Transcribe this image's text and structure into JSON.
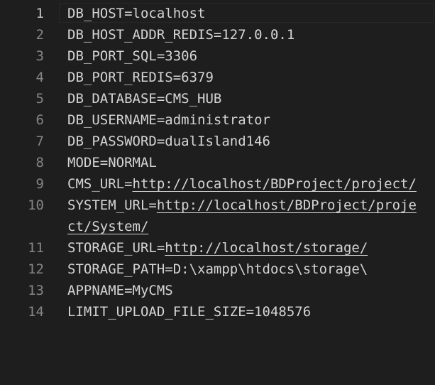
{
  "editor": {
    "lines": [
      {
        "number": "1",
        "text": "DB_HOST=localhost"
      },
      {
        "number": "2",
        "text": "DB_HOST_ADDR_REDIS=127.0.0.1"
      },
      {
        "number": "3",
        "text": "DB_PORT_SQL=3306"
      },
      {
        "number": "4",
        "text": "DB_PORT_REDIS=6379"
      },
      {
        "number": "5",
        "text": "DB_DATABASE=CMS_HUB"
      },
      {
        "number": "6",
        "text": "DB_USERNAME=administrator"
      },
      {
        "number": "7",
        "text": "DB_PASSWORD=dualIsland146"
      },
      {
        "number": "8",
        "text": "MODE=NORMAL"
      },
      {
        "number": "9",
        "key": "CMS_URL=",
        "url": "http://localhost/BDProject/project/"
      },
      {
        "number": "10",
        "key": "SYSTEM_URL=",
        "url": "http://localhost/BDProject/project/System/"
      },
      {
        "number": "11",
        "key": "STORAGE_URL=",
        "url": "http://localhost/storage/"
      },
      {
        "number": "12",
        "text": "STORAGE_PATH=D:\\xampp\\htdocs\\storage\\"
      },
      {
        "number": "13",
        "text": "APPNAME=MyCMS"
      },
      {
        "number": "14",
        "text": "LIMIT_UPLOAD_FILE_SIZE=1048576"
      }
    ]
  }
}
